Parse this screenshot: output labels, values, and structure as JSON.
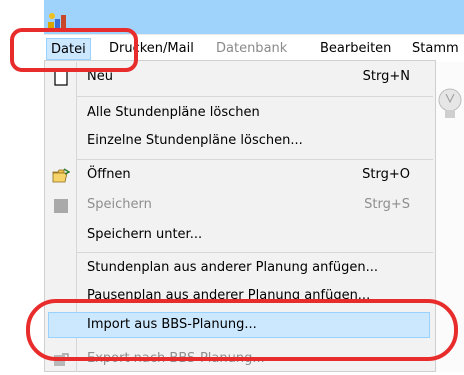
{
  "colors": {
    "titlebar": "#9fd3fb",
    "highlight": "#cce8ff",
    "highlight_border": "#99d1ff",
    "callout": "#e82c2c",
    "disabled_text": "#8e8e8e"
  },
  "menubar": {
    "datei": "Datei",
    "drucken_mail": "Drucken/Mail",
    "datenbank": "Datenbank",
    "bearbeiten": "Bearbeiten",
    "stammdaten_partial": "Stamm"
  },
  "dropdown": {
    "items": [
      {
        "label": "Neu",
        "shortcut": "Strg+N",
        "icon": "new-document-icon",
        "enabled": true
      },
      {
        "label": "Alle Stundenpläne löschen",
        "shortcut": "",
        "enabled": true
      },
      {
        "label": "Einzelne Stundenpläne löschen...",
        "shortcut": "",
        "enabled": true
      },
      {
        "label": "Öffnen",
        "shortcut": "Strg+O",
        "icon": "open-folder-icon",
        "enabled": true
      },
      {
        "label": "Speichern",
        "shortcut": "Strg+S",
        "icon": "save-icon",
        "enabled": false
      },
      {
        "label": "Speichern unter...",
        "shortcut": "",
        "enabled": true
      },
      {
        "label": "Stundenplan aus anderer Planung anfügen...",
        "shortcut": "",
        "enabled": true
      },
      {
        "label": "Pausenplan aus anderer Planung anfügen...",
        "shortcut": "",
        "enabled": true
      },
      {
        "label": "Import aus BBS-Planung...",
        "shortcut": "",
        "enabled": true,
        "highlighted": true
      },
      {
        "label": "Export nach BBS-Planung...",
        "shortcut": "",
        "icon": "export-icon",
        "enabled": false
      }
    ]
  }
}
